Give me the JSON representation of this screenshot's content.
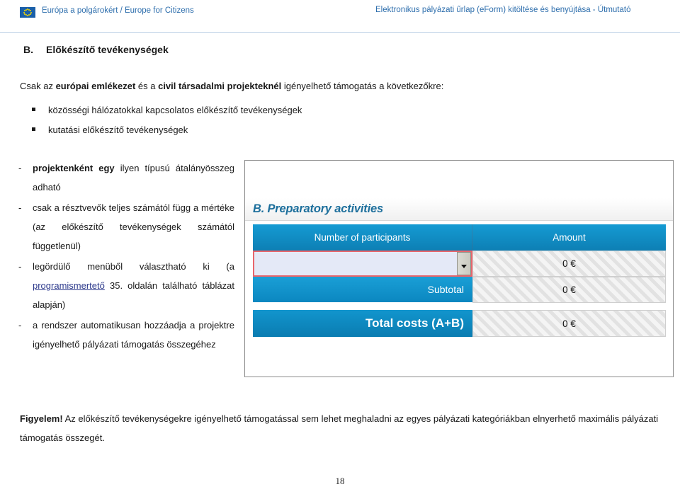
{
  "header": {
    "brand": "Európa a polgárokért / Europe for Citizens",
    "logo_name": "eu-flag-logo",
    "doc_title": "Elektronikus pályázati űrlap (eForm) kitöltése és benyújtása - Útmutató"
  },
  "section": {
    "letter": "B.",
    "title": "Előkészítő tevékenységek"
  },
  "intro": {
    "part1": "Csak az ",
    "bold1": "európai emlékezet",
    "part2": " és a ",
    "bold2": "civil társadalmi projekteknél",
    "part3": " igényelhető támogatás a következőkre:"
  },
  "bullets": [
    "közösségi hálózatokkal kapcsolatos előkészítő tevékenységek",
    "kutatási előkészítő tevékenységek"
  ],
  "notes": [
    {
      "mark": "-",
      "bold_lead": "projektenként egy",
      "text": " ilyen típusú átalányösszeg adható"
    },
    {
      "mark": "-",
      "bold_lead": "",
      "text": "csak a résztvevők teljes számától függ a mértéke (az előkészítő tevékenységek számától függetlenül)"
    },
    {
      "mark": "-",
      "bold_lead": "",
      "text_before_link": "legördülő menüből választható ki (a ",
      "link": "programismertető",
      "text_after_link": " 35. oldalán található táblázat alapján)"
    },
    {
      "mark": "-",
      "bold_lead": "",
      "text": "a rendszer automatikusan hozzáadja a projektre igényelhető pályázati támogatás összegéhez"
    }
  ],
  "form": {
    "section_title": "B. Preparatory activities",
    "columns": {
      "participants": "Number of participants",
      "amount": "Amount"
    },
    "input_row": {
      "value": "",
      "placeholder": "",
      "amount": "0 €",
      "dropdown_icon": "chevron-down-icon",
      "highlight_color": "#e8656c"
    },
    "subtotal": {
      "label": "Subtotal",
      "amount": "0 €"
    },
    "total": {
      "label": "Total costs (A+B)",
      "amount": "0 €"
    },
    "colors": {
      "header_blue": "#0d7fb4",
      "section_teal": "#1d6f9c",
      "input_fill": "#e4e9f7"
    }
  },
  "warning": {
    "lead": "Figyelem!",
    "text": " Az előkészítő tevékenységekre igényelhető támogatással sem lehet meghaladni az egyes pályázati kategóriákban elnyerhető maximális pályázati támogatás összegét."
  },
  "footer": {
    "page_number": "18"
  }
}
